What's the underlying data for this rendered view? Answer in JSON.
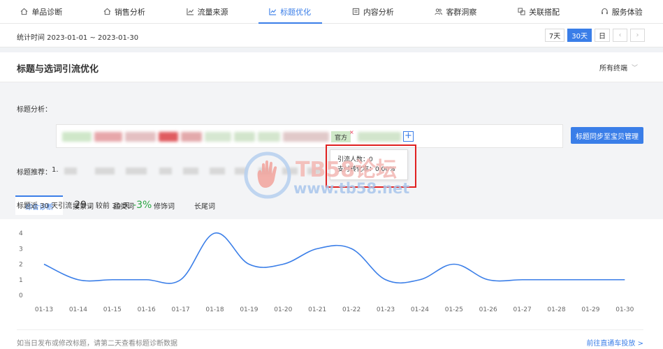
{
  "nav": {
    "items": [
      {
        "label": "单品诊断",
        "icon": "house-icon"
      },
      {
        "label": "销售分析",
        "icon": "house-icon"
      },
      {
        "label": "流量来源",
        "icon": "line-chart-icon"
      },
      {
        "label": "标题优化",
        "icon": "line-chart-icon",
        "active": true
      },
      {
        "label": "内容分析",
        "icon": "document-icon"
      },
      {
        "label": "客群洞察",
        "icon": "users-icon"
      },
      {
        "label": "关联搭配",
        "icon": "link-icon"
      },
      {
        "label": "服务体验",
        "icon": "headset-icon"
      }
    ]
  },
  "datebar": {
    "range": "统计时间 2023-01-01 ~ 2023-01-30",
    "periods": [
      "7天",
      "30天",
      "日"
    ],
    "active_period": "30天",
    "prev": "‹",
    "next": "›"
  },
  "section": {
    "title": "标题与选词引流优化",
    "terminal": "所有终端"
  },
  "title_analysis": {
    "label": "标题分析：",
    "tag_official": "官方",
    "tag_remove": "×",
    "add": "+",
    "sync_button": "标题同步至宝贝管理"
  },
  "tooltip": {
    "visitors": "引流人数：0",
    "conversion": "支付转化率：0.00%"
  },
  "title_recommend": {
    "label": "标题推荐：",
    "index": "1."
  },
  "tabs": [
    "综合诊断",
    "搜索词",
    "品类词",
    "修饰词",
    "长尾词"
  ],
  "summary": {
    "prefix": "标题近 30 天引流",
    "count": "29",
    "compare": "，较前 30 天",
    "change": "-3%"
  },
  "chart_data": {
    "type": "line",
    "x": [
      "01-13",
      "01-14",
      "01-15",
      "01-16",
      "01-17",
      "01-18",
      "01-19",
      "01-20",
      "01-21",
      "01-22",
      "01-23",
      "01-24",
      "01-25",
      "01-26",
      "01-27",
      "01-28",
      "01-29",
      "01-30"
    ],
    "series": [
      {
        "values": [
          2,
          1,
          1,
          1,
          1,
          4,
          2,
          2,
          3,
          3,
          1,
          1,
          2,
          1,
          1,
          1,
          1,
          1
        ]
      }
    ],
    "yticks": [
      0,
      1,
      2,
      3,
      4
    ],
    "ylim": [
      0,
      4
    ],
    "color": "#3a7ee8"
  },
  "footer": {
    "note": "如当日发布或修改标题，请第二天查看标题诊断数据",
    "link": "前往直通车投放 >"
  },
  "watermark": {
    "line1": "TB58论坛",
    "line2": "www.tb58.net"
  }
}
